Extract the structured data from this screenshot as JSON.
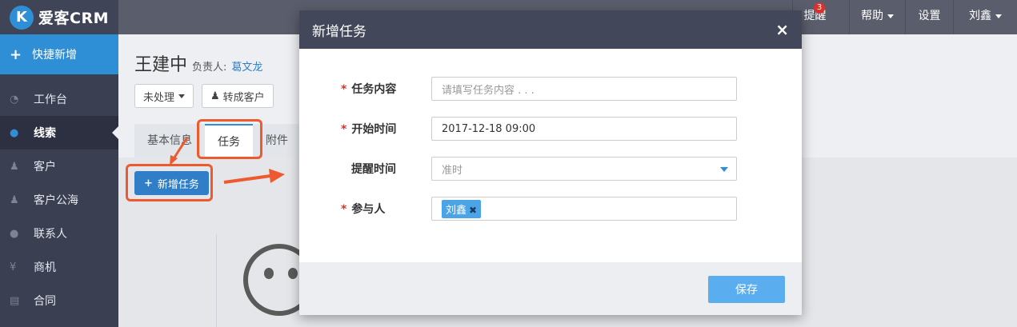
{
  "brand": {
    "logo_letter": "K",
    "name": "爱客CRM"
  },
  "topnav": {
    "reminder": "提醒",
    "reminder_count": "3",
    "help": "帮助",
    "settings": "设置",
    "user": "刘鑫"
  },
  "sidebar": {
    "quick_add": "快捷新增",
    "items": [
      {
        "label": "工作台",
        "icon": "dashboard-icon",
        "glyph": "◔"
      },
      {
        "label": "线索",
        "icon": "globe-icon",
        "glyph": "●"
      },
      {
        "label": "客户",
        "icon": "users-icon",
        "glyph": "♟"
      },
      {
        "label": "客户公海",
        "icon": "users-icon",
        "glyph": "♟"
      },
      {
        "label": "联系人",
        "icon": "chat-icon",
        "glyph": "●"
      },
      {
        "label": "商机",
        "icon": "yen-icon",
        "glyph": "¥"
      },
      {
        "label": "合同",
        "icon": "document-icon",
        "glyph": "▤"
      }
    ]
  },
  "lead": {
    "name": "王建中",
    "owner_label": "负责人:",
    "owner": "葛文龙",
    "status": "未处理",
    "convert": "转成客户",
    "tabs": [
      "基本信息",
      "任务",
      "附件"
    ],
    "new_task": "新增任务"
  },
  "modal": {
    "title": "新增任务",
    "close": "×",
    "fields": {
      "content_label": "任务内容",
      "content_placeholder": "请填写任务内容 . . .",
      "start_label": "开始时间",
      "start_value": "2017-12-18 09:00",
      "remind_label": "提醒时间",
      "remind_value": "准时",
      "participants_label": "参与人",
      "participant": "刘鑫"
    },
    "save": "保存"
  },
  "colors": {
    "accent": "#2f8fd6",
    "annotation": "#ee5a2f"
  }
}
